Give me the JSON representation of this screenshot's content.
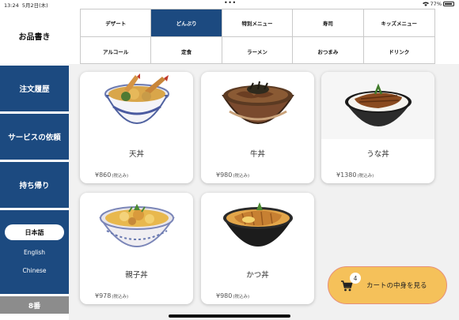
{
  "status_bar": {
    "time": "13:24",
    "date": "5月2日(木)",
    "dots": "•••",
    "battery": "77%"
  },
  "sidebar": {
    "title": "お品書き",
    "history": "注文履歴",
    "service": "サービスの依頼",
    "takeout": "持ち帰り",
    "languages": [
      "日本語",
      "English",
      "Chinese"
    ],
    "table_number": "8番"
  },
  "categories": [
    {
      "label": "デザート",
      "active": false
    },
    {
      "label": "どんぶり",
      "active": true
    },
    {
      "label": "特別メニュー",
      "active": false
    },
    {
      "label": "寿司",
      "active": false
    },
    {
      "label": "キッズメニュー",
      "active": false
    },
    {
      "label": "アルコール",
      "active": false
    },
    {
      "label": "定食",
      "active": false
    },
    {
      "label": "ラーメン",
      "active": false
    },
    {
      "label": "おつまみ",
      "active": false
    },
    {
      "label": "ドリンク",
      "active": false
    }
  ],
  "products": [
    {
      "name": "天丼",
      "price": "¥860",
      "tax": "(税込み)"
    },
    {
      "name": "牛丼",
      "price": "¥980",
      "tax": "(税込み)"
    },
    {
      "name": "うな丼",
      "price": "¥1380",
      "tax": "(税込み)"
    },
    {
      "name": "親子丼",
      "price": "¥978",
      "tax": "(税込み)"
    },
    {
      "name": "かつ丼",
      "price": "¥980",
      "tax": "(税込み)"
    }
  ],
  "cart": {
    "count": "4",
    "label": "カートの中身を見る"
  },
  "colors": {
    "brand_blue": "#1c4a80",
    "cart_yellow": "#f5c15a",
    "table_gray": "#8c8c8c"
  }
}
